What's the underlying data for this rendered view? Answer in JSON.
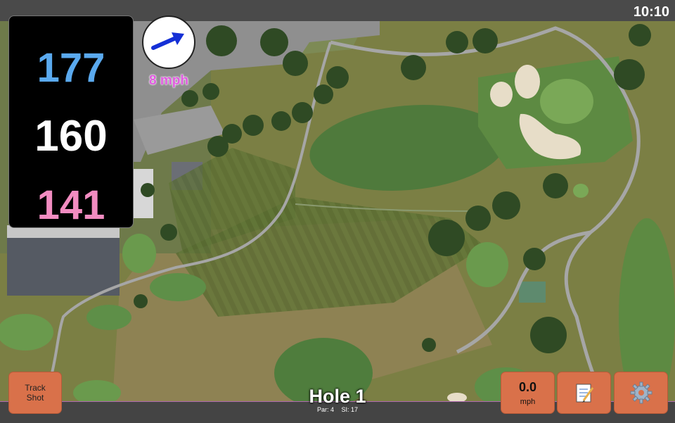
{
  "status_bar": {
    "time": "10:10"
  },
  "distances": {
    "back": "177",
    "middle": "160",
    "front": "141",
    "colors": {
      "back": "#5aa9ee",
      "middle": "#ffffff",
      "front": "#f28cc1"
    }
  },
  "wind": {
    "speed_label": "8 mph",
    "direction_icon": "arrow-icon"
  },
  "buttons": {
    "track_shot": "Track\nShot",
    "speed_value": "0.0",
    "speed_unit": "mph",
    "notes_icon": "notepad-icon",
    "settings_icon": "gear-icon"
  },
  "hole": {
    "title": "Hole 1",
    "par": "Par: 4",
    "si": "SI: 17"
  },
  "accent_color": "#d9714a"
}
